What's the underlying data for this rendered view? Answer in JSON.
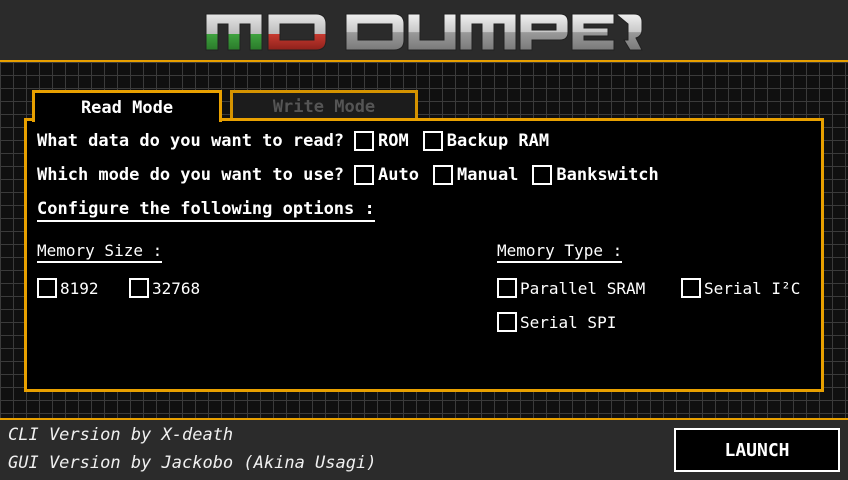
{
  "app": {
    "logo_text": "MD DUMPER",
    "colors": {
      "accent": "#e8a000",
      "logo_green": "#3a9a3a",
      "logo_red": "#c0302a",
      "logo_silver": "#d8d8d8"
    }
  },
  "tabs": [
    {
      "label": "Read Mode",
      "active": true
    },
    {
      "label": "Write Mode",
      "active": false
    }
  ],
  "read_panel": {
    "data_question": "What data do you want to read?",
    "data_options": [
      "ROM",
      "Backup RAM"
    ],
    "mode_question": "Which mode do you want to use?",
    "mode_options": [
      "Auto",
      "Manual",
      "Bankswitch"
    ],
    "options_heading": "Configure the following options :",
    "memory_size": {
      "label": "Memory Size :",
      "options": [
        "8192",
        "32768"
      ]
    },
    "memory_type": {
      "label": "Memory Type :",
      "options": [
        "Parallel SRAM",
        "Serial I²C",
        "Serial SPI"
      ]
    }
  },
  "footer": {
    "cli_credit": "CLI Version by X-death",
    "gui_credit": "GUI Version by Jackobo (Akina Usagi)",
    "launch_label": "LAUNCH"
  }
}
